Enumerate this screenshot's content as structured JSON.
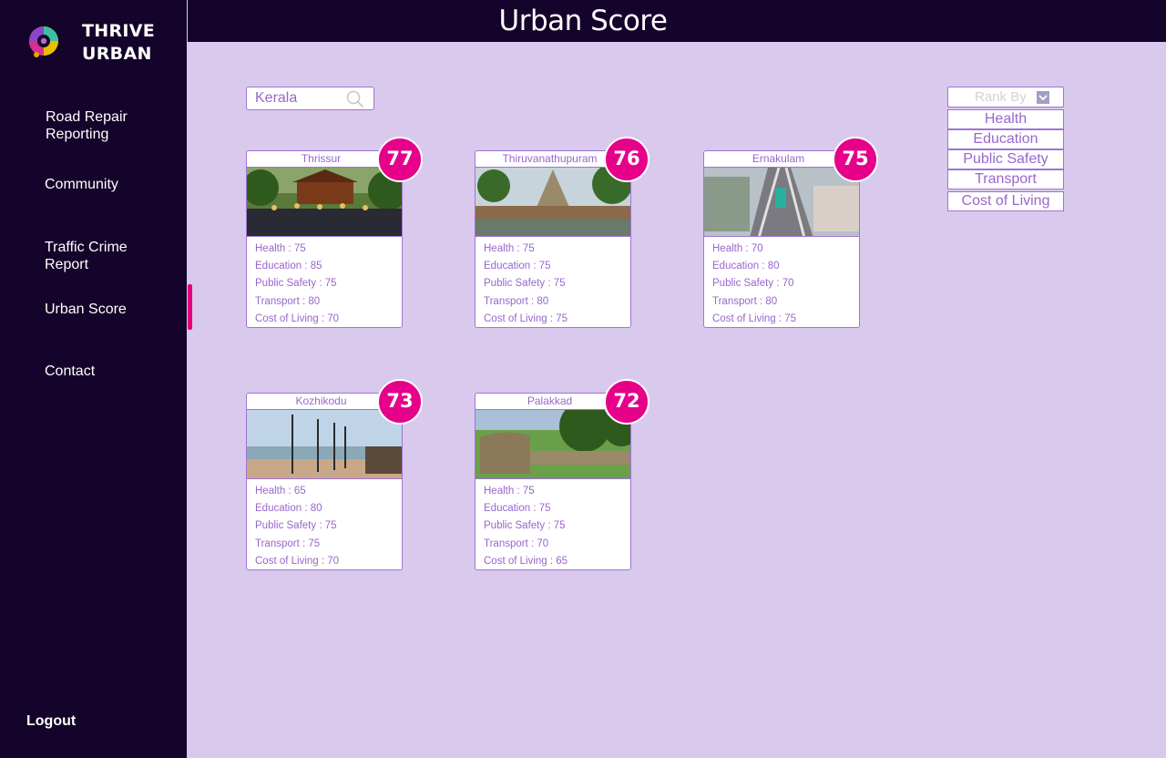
{
  "brand": {
    "line1": "THRIVE",
    "line2": "URBAN"
  },
  "nav": {
    "road_repair": "Road Repair Reporting",
    "community": "Community",
    "traffic_crime": "Traffic Crime Report",
    "urban_score": "Urban Score",
    "contact": "Contact",
    "logout": "Logout"
  },
  "header": {
    "title": "Urban Score"
  },
  "search": {
    "value": "Kerala",
    "icon": "search-icon"
  },
  "rank": {
    "label": "Rank By",
    "options": [
      "Health",
      "Education",
      "Public Safety",
      "Transport",
      "Cost of Living"
    ]
  },
  "colors": {
    "accent": "#e6008a",
    "sidebar": "#14032a",
    "background": "#d9c9ec",
    "text": "#9966cc"
  },
  "cities": [
    {
      "name": "Thrissur",
      "score": "77",
      "stats": [
        "Health : 75",
        "Education : 85",
        "Public Safety : 75",
        "Transport : 80",
        "Cost of Living : 70"
      ]
    },
    {
      "name": "Thiruvanathupuram",
      "score": "76",
      "stats": [
        "Health : 75",
        "Education : 75",
        "Public Safety : 75",
        "Transport : 80",
        "Cost of Living : 75"
      ]
    },
    {
      "name": "Ernakulam",
      "score": "75",
      "stats": [
        "Health : 70",
        "Education : 80",
        "Public Safety : 70",
        "Transport : 80",
        "Cost of Living : 75"
      ]
    },
    {
      "name": "Kozhikodu",
      "score": "73",
      "stats": [
        "Health : 65",
        "Education : 80",
        "Public Safety : 75",
        "Transport : 75",
        "Cost of Living : 70"
      ]
    },
    {
      "name": "Palakkad",
      "score": "72",
      "stats": [
        "Health : 75",
        "Education : 75",
        "Public Safety : 75",
        "Transport : 70",
        "Cost of Living : 65"
      ]
    }
  ]
}
